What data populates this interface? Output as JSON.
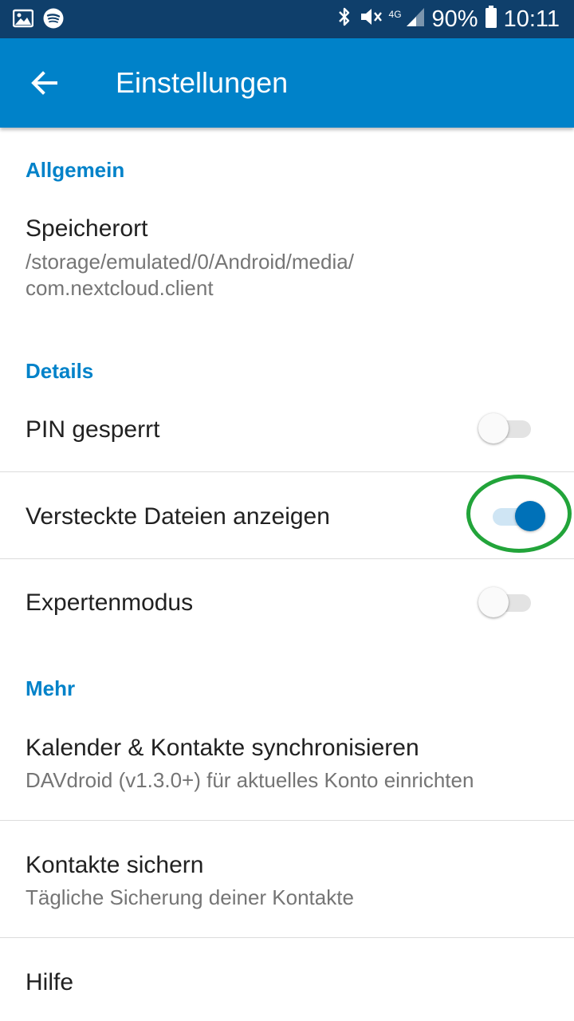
{
  "status_bar": {
    "network_label": "4G",
    "battery_percent": "90%",
    "time": "10:11",
    "icons": [
      "image-icon",
      "spotify-icon",
      "bluetooth-icon",
      "mute-icon",
      "signal-icon",
      "battery-icon"
    ]
  },
  "app_bar": {
    "title": "Einstellungen",
    "back_icon": "arrow-back-icon"
  },
  "sections": {
    "general": {
      "header": "Allgemein",
      "storage": {
        "title": "Speicherort",
        "summary_line1": "/storage/emulated/0/Android/media/",
        "summary_line2": "com.nextcloud.client"
      }
    },
    "details": {
      "header": "Details",
      "pin": {
        "title": "PIN gesperrt",
        "enabled": false
      },
      "hidden_files": {
        "title": "Versteckte Dateien anzeigen",
        "enabled": true
      },
      "expert_mode": {
        "title": "Expertenmodus",
        "enabled": false
      }
    },
    "more": {
      "header": "Mehr",
      "sync": {
        "title": "Kalender & Kontakte synchronisieren",
        "summary": "DAVdroid (v1.3.0+) für aktuelles Konto einrichten"
      },
      "backup": {
        "title": "Kontakte sichern",
        "summary": "Tägliche Sicherung deiner Kontakte"
      },
      "help": {
        "title": "Hilfe"
      }
    }
  },
  "colors": {
    "status_bar": "#0f3f6b",
    "app_bar": "#0082c9",
    "accent": "#0082c9",
    "toggle_on": "#0071b8",
    "highlight": "#22a43a"
  }
}
